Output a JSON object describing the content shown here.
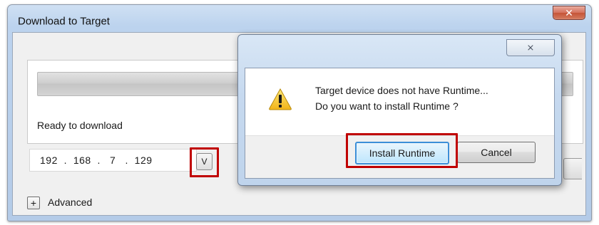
{
  "window": {
    "title": "Download to Target",
    "close_icon": "close-icon"
  },
  "download_panel": {
    "status_text": "Ready to download"
  },
  "target": {
    "ip_octets": [
      "192",
      "168",
      "7",
      "129"
    ],
    "ip_separator": ".",
    "dropdown_label": "V"
  },
  "advanced": {
    "expand_label": "+",
    "label": "Advanced"
  },
  "dialog": {
    "close_icon": "close-icon",
    "warning_icon": "warning-icon",
    "message_line1": "Target device does not have Runtime...",
    "message_line2": "Do you want to install Runtime ?",
    "install_label": "Install Runtime",
    "cancel_label": "Cancel"
  },
  "highlight_color": "#c00000",
  "accent_color": "#3c8fd8"
}
